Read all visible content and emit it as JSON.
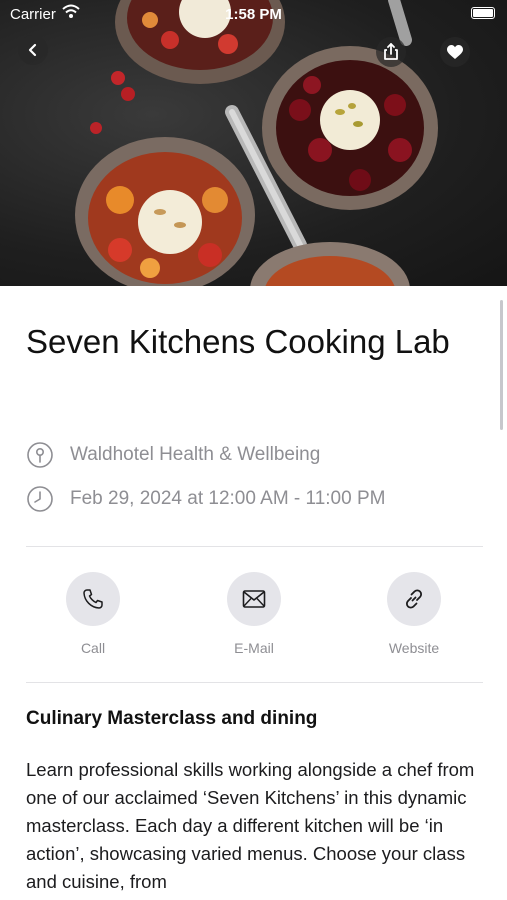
{
  "status_bar": {
    "carrier": "Carrier",
    "time": "1:58 PM"
  },
  "event": {
    "title": "Seven Kitchens Cooking Lab",
    "location": "Waldhotel Health & Wellbeing",
    "datetime": "Feb 29, 2024 at 12:00 AM - 11:00 PM"
  },
  "actions": {
    "call_label": "Call",
    "email_label": "E-Mail",
    "website_label": "Website"
  },
  "details": {
    "heading": "Culinary Masterclass and dining",
    "description": "Learn professional skills working alongside a chef from one of our acclaimed ‘Seven Kitchens’ in this dynamic masterclass. Each day a different kitchen will be ‘in action’, showcasing varied menus. Choose your class and cuisine, from"
  },
  "icons": {
    "back": "chevron-left-icon",
    "share": "share-icon",
    "favorite": "heart-icon",
    "location": "location-pin-icon",
    "time": "clock-icon",
    "call": "phone-icon",
    "email": "envelope-icon",
    "website": "link-icon"
  },
  "colors": {
    "secondary_text": "#8e8e93",
    "action_circle": "#e5e5ea",
    "divider": "#e3e3e6"
  }
}
